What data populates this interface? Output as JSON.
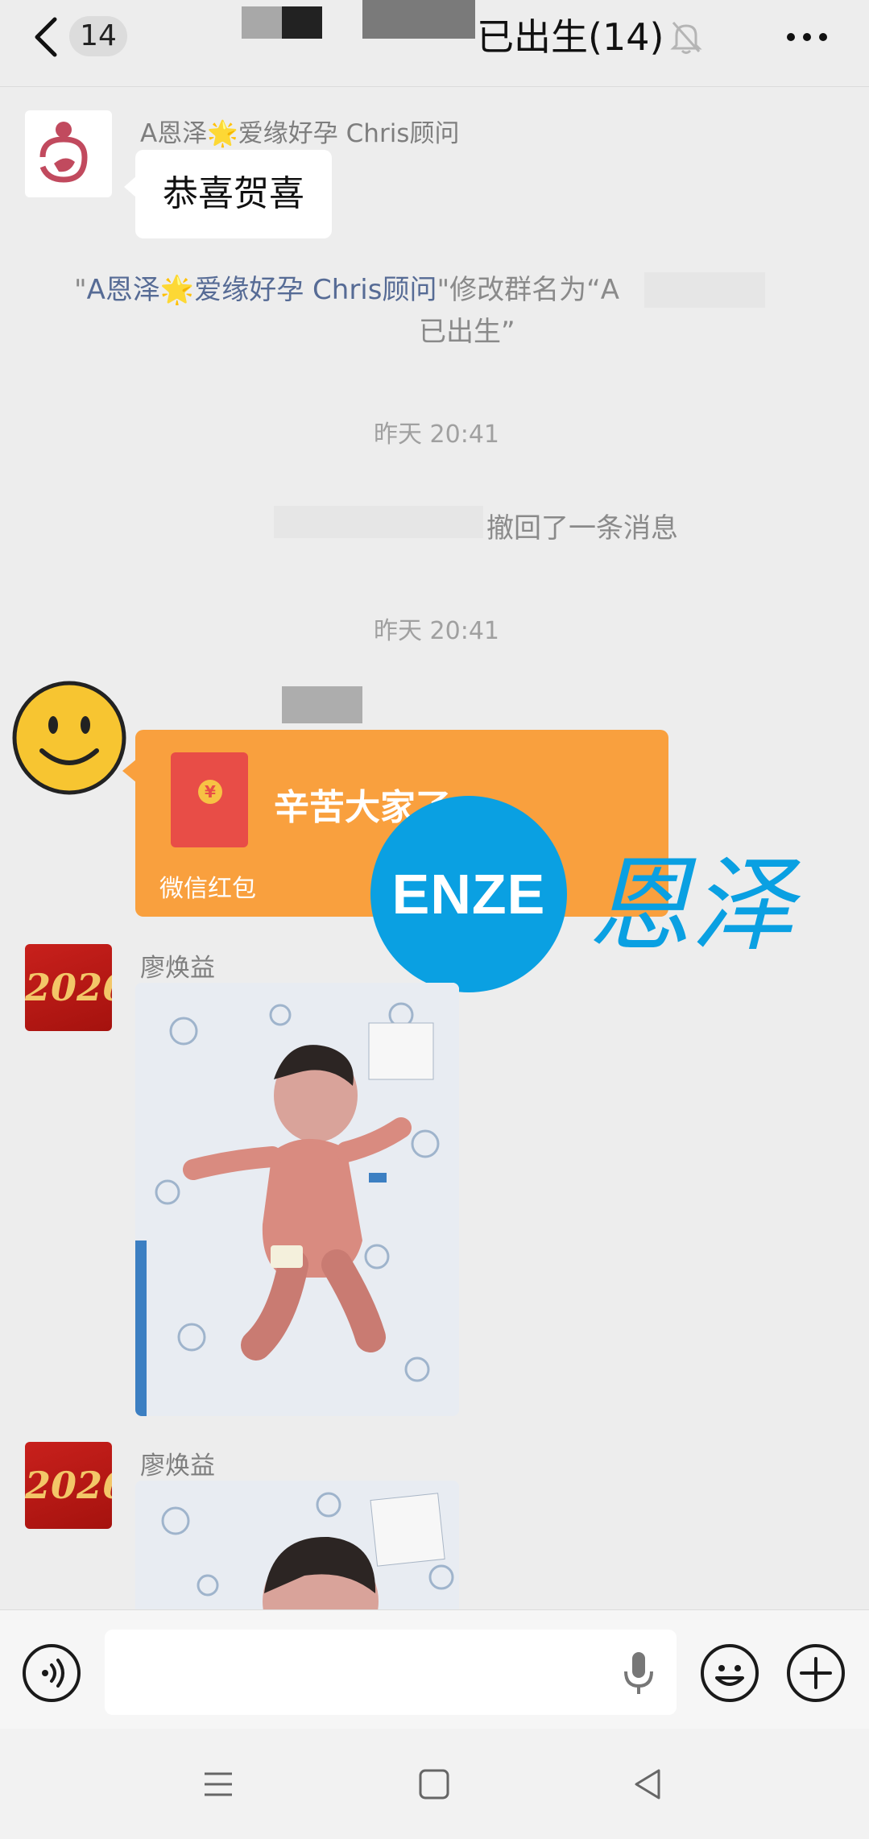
{
  "header": {
    "unread_count": "14",
    "title": "已出生(14)"
  },
  "messages": {
    "m1": {
      "sender": "A恩泽🌟爱缘好孕 Chris顾问",
      "text": "恭喜贺喜"
    },
    "rename": {
      "quote_open": "\"",
      "actor": "A恩泽🌟爱缘好孕 Chris顾问",
      "line1_rest": "\"修改群名为“A",
      "line2": "已出生”"
    },
    "time1": "昨天 20:41",
    "recall": "撤回了一条消息",
    "time2": "昨天 20:41",
    "red_packet": {
      "title": "辛苦大家了",
      "footer": "微信红包",
      "coin": "¥"
    },
    "photo1": {
      "sender": "廖焕益"
    },
    "photo2": {
      "sender": "廖焕益"
    }
  },
  "watermark": {
    "brand": "ENZE",
    "chinese": "恩泽"
  },
  "avatars": {
    "year_label": "2026"
  },
  "colors": {
    "background": "#ededed",
    "red_packet": "#f9a03e",
    "watermark_blue": "#0aa0e2",
    "link_blue": "#566b95"
  },
  "icons": {
    "back": "chevron-left-icon",
    "mute": "bell-off-icon",
    "more": "more-horizontal-icon",
    "voice": "voice-icon",
    "mic": "microphone-icon",
    "emoji": "emoji-icon",
    "add": "plus-icon"
  }
}
